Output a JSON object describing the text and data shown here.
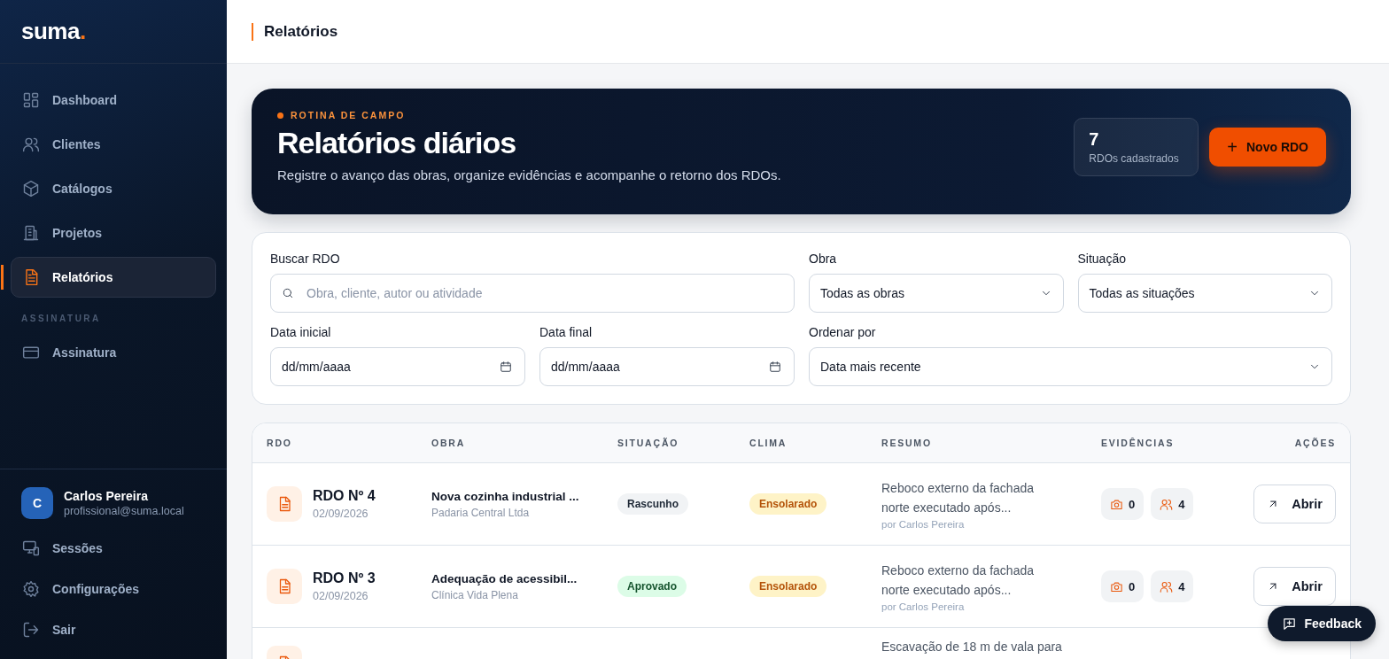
{
  "sidebar": {
    "logo": "suma",
    "logo_dot": ".",
    "items": [
      {
        "label": "Dashboard",
        "selected": false
      },
      {
        "label": "Clientes",
        "selected": false
      },
      {
        "label": "Catálogos",
        "selected": false
      },
      {
        "label": "Projetos",
        "selected": false
      },
      {
        "label": "Relatórios",
        "selected": true
      }
    ],
    "section_label": "ASSINATURA",
    "section_items": [
      {
        "label": "Assinatura",
        "selected": false
      }
    ],
    "user": {
      "initial": "C",
      "name": "Carlos Pereira",
      "email": "profissional@suma.local"
    },
    "footer_items": [
      {
        "label": "Sessões"
      },
      {
        "label": "Configurações"
      },
      {
        "label": "Sair"
      }
    ]
  },
  "header": {
    "title": "Relatórios"
  },
  "hero": {
    "eyebrow": "ROTINA DE CAMPO",
    "title": "Relatórios diários",
    "subtitle": "Registre o avanço das obras, organize evidências e acompanhe o retorno dos RDOs.",
    "count": "7",
    "count_label": "RDOs cadastrados",
    "button": "Novo RDO",
    "button_icon": "+"
  },
  "filters": {
    "search": {
      "label": "Buscar RDO",
      "placeholder": "Obra, cliente, autor ou atividade"
    },
    "obra": {
      "label": "Obra",
      "value": "Todas as obras"
    },
    "situacao": {
      "label": "Situação",
      "value": "Todas as situações"
    },
    "data_inicial": {
      "label": "Data inicial",
      "placeholder": "dd/mm/aaaa"
    },
    "data_final": {
      "label": "Data final",
      "placeholder": "dd/mm/aaaa"
    },
    "ordenar": {
      "label": "Ordenar por",
      "value": "Data mais recente"
    }
  },
  "table": {
    "columns": [
      "RDO",
      "OBRA",
      "SITUAÇÃO",
      "CLIMA",
      "RESUMO",
      "EVIDÊNCIAS",
      "AÇÕES"
    ],
    "rows": [
      {
        "number": "RDO Nº 4",
        "date": "02/09/2026",
        "obra": "Nova cozinha industrial ...",
        "cliente": "Padaria Central Ltda",
        "status": {
          "label": "Rascunho",
          "kind": "draft"
        },
        "weather": {
          "label": "Ensolarado",
          "kind": "sunny"
        },
        "summary": "Reboco externo da fachada norte executado após...",
        "author": "por Carlos Pereira",
        "photos": "0",
        "people": "4",
        "action": "Abrir"
      },
      {
        "number": "RDO Nº 3",
        "date": "02/09/2026",
        "obra": "Adequação de acessibil...",
        "cliente": "Clínica Vida Plena",
        "status": {
          "label": "Aprovado",
          "kind": "approved"
        },
        "weather": {
          "label": "Ensolarado",
          "kind": "sunny"
        },
        "summary": "Reboco externo da fachada norte executado após...",
        "author": "por Carlos Pereira",
        "photos": "0",
        "people": "4",
        "action": "Abrir"
      },
      {
        "summary": "Escavação de 18 m de vala para"
      }
    ]
  },
  "feedback": {
    "label": "Feedback"
  }
}
